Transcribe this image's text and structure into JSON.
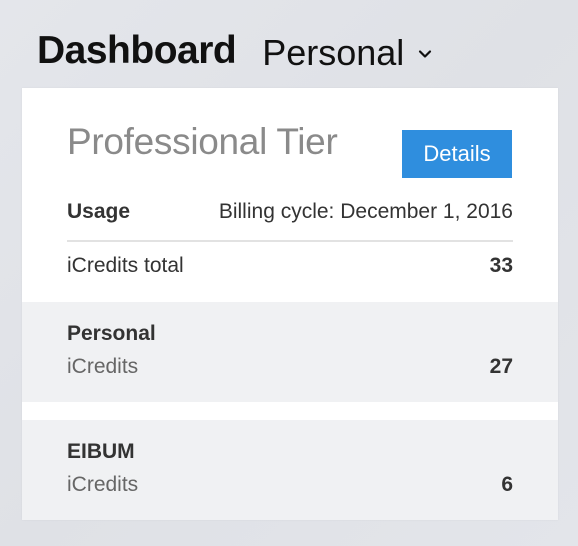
{
  "header": {
    "title": "Dashboard",
    "workspace": "Personal",
    "workspace_icon": "chevron-down-icon"
  },
  "card": {
    "tier_title": "Professional Tier",
    "details_label": "Details",
    "usage_label": "Usage",
    "billing_cycle": "Billing cycle: December 1, 2016",
    "total_label": "iCredits total",
    "total_value": "33",
    "accounts": [
      {
        "name": "Personal",
        "sub_label": "iCredits",
        "value": "27"
      },
      {
        "name": "EIBUM",
        "sub_label": "iCredits",
        "value": "6"
      }
    ]
  },
  "colors": {
    "accent": "#2f8ede",
    "background": "#e2e4e9",
    "row_background": "#f0f1f3"
  }
}
